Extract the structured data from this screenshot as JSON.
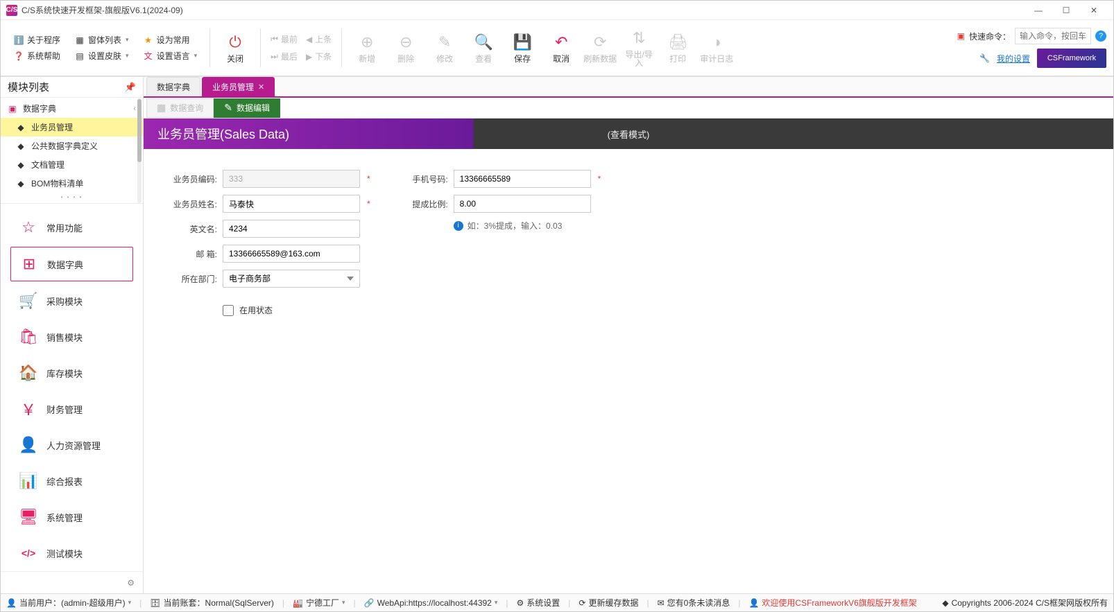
{
  "window": {
    "title": "C/S系统快速开发框架-旗舰版V6.1(2024-09)",
    "app_icon_text": "C/S"
  },
  "ribbon": {
    "small": {
      "about": "关于程序",
      "win_list": "窗体列表",
      "set_common": "设为常用",
      "sys_help": "系统帮助",
      "set_skin": "设置皮肤",
      "set_lang": "设置语言"
    },
    "close": "关闭",
    "nav": {
      "first": "最前",
      "prev": "上条",
      "last": "最后",
      "next": "下条"
    },
    "large": {
      "add": "新增",
      "del": "删除",
      "edit": "修改",
      "view": "查看",
      "save": "保存",
      "cancel": "取消",
      "refresh": "刷新数据",
      "export": "导出/导入",
      "print": "打印",
      "audit": "审计日志"
    },
    "quick_label": "快速命令：",
    "quick_placeholder": "输入命令，按回车",
    "my_settings": "我的设置",
    "brand": "CSFramework"
  },
  "sidebar": {
    "title": "模块列表",
    "tree": {
      "root": "数据字典",
      "items": [
        "业务员管理",
        "公共数据字典定义",
        "文档管理",
        "BOM物料清单"
      ]
    },
    "modules": [
      {
        "icon": "☆",
        "label": "常用功能"
      },
      {
        "icon": "⊞",
        "label": "数据字典"
      },
      {
        "icon": "🛒",
        "label": "采购模块"
      },
      {
        "icon": "🛍",
        "label": "销售模块"
      },
      {
        "icon": "🏠",
        "label": "库存模块"
      },
      {
        "icon": "￥",
        "label": "财务管理"
      },
      {
        "icon": "👤",
        "label": "人力资源管理"
      },
      {
        "icon": "📊",
        "label": "综合报表"
      },
      {
        "icon": "🖥",
        "label": "系统管理"
      },
      {
        "icon": "</>",
        "label": "测试模块"
      }
    ]
  },
  "tabs": [
    {
      "label": "数据字典",
      "active": false
    },
    {
      "label": "业务员管理",
      "active": true
    }
  ],
  "subtabs": {
    "query": "数据查询",
    "edit": "数据编辑"
  },
  "page": {
    "title": "业务员管理(Sales Data)",
    "mode": "(查看模式)"
  },
  "form": {
    "code_label": "业务员编码:",
    "code_value": "333",
    "name_label": "业务员姓名:",
    "name_value": "马泰快",
    "en_label": "英文名:",
    "en_value": "4234",
    "mail_label": "邮   箱:",
    "mail_value": "13366665589@163.com",
    "dept_label": "所在部门:",
    "dept_value": "电子商务部",
    "phone_label": "手机号码:",
    "phone_value": "13366665589",
    "rate_label": "提成比例:",
    "rate_value": "8.00",
    "rate_hint": "如：3%提成，输入：0.03",
    "active_label": "在用状态"
  },
  "status": {
    "user": "当前用户：(admin-超级用户)",
    "account": "当前账套：Normal(SqlServer)",
    "factory": "宁德工厂",
    "webapi": "WebApi:https://localhost:44392",
    "sys_settings": "系统设置",
    "refresh_cache": "更新缓存数据",
    "unread": "您有0条未读消息",
    "welcome": "欢迎使用CSFrameworkV6旗舰版开发框架",
    "copyright": "Copyrights 2006-2024 C/S框架网版权所有"
  }
}
